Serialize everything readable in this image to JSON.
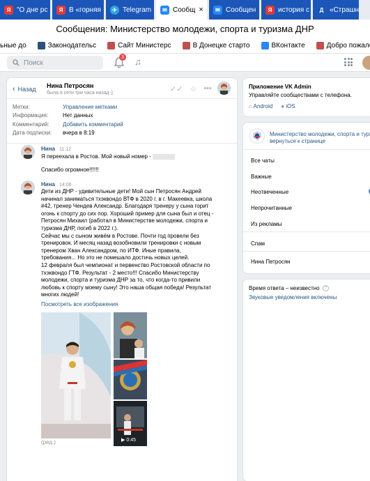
{
  "tabs": [
    {
      "icon": "Я",
      "kind": "y",
      "label": "\"О дне рс"
    },
    {
      "icon": "Я",
      "kind": "y",
      "label": "В «горняя"
    },
    {
      "icon": "✈",
      "kind": "tg",
      "label": "Telegram"
    },
    {
      "icon": "✉",
      "kind": "vk",
      "label": "Сообщ",
      "active": true,
      "close": "×"
    },
    {
      "icon": "✉",
      "kind": "vk",
      "label": "Сообщен"
    },
    {
      "icon": "Я",
      "kind": "y",
      "label": "история с"
    },
    {
      "icon": "Д",
      "kind": "d",
      "label": "«Страшн"
    }
  ],
  "window_title": "Сообщения: Министерство молодежи, спорта и туризма ДНР",
  "bookmarks": [
    {
      "label": "ьные до",
      "color": "#4a76a8"
    },
    {
      "label": "Законодательс",
      "color": "#2b5278"
    },
    {
      "label": "Сайт Министерс",
      "color": "#c0504d"
    },
    {
      "label": "В Донецке старто",
      "color": "#c0504d"
    },
    {
      "label": "ВКонтакте",
      "color": "#2787f5"
    },
    {
      "label": "Добро пожалова",
      "color": "#c0504d"
    }
  ],
  "vk_header": {
    "search_placeholder": "Поиск",
    "notifications_count": "3"
  },
  "chat": {
    "back_label": "Назад",
    "peer_name": "Нина Петросян",
    "peer_status": "была в сети три часа назад",
    "info": [
      {
        "key": "Метки:",
        "value": "Управление метками",
        "link": true
      },
      {
        "key": "Информация:",
        "value": "Нет данных",
        "link": false
      },
      {
        "key": "Комментарий:",
        "value": "Добавить комментарий",
        "link": true
      },
      {
        "key": "Дата подписки:",
        "value": "вчера в 8:19",
        "link": false
      }
    ],
    "messages": [
      {
        "author": "Нина",
        "time": "11:12",
        "text_before": "Я переехала в Ростов. Мой новый номер -",
        "text_after": "Спасибо огромное!!!!!!"
      },
      {
        "author": "Нина",
        "time": "14:06",
        "text": "Дети из ДНР - удивительные дети! Мой сын Петросян Андрей начинал заниматься тхэквондо ВТФ в 2020 г. в г. Макеевка, школа #42, тренер Чендев Александр. Благодаря тренеру у сына горит огонь к спорту до сих пор. Хороший пример для сына был и отец - Петросян Михаил (работал в Министерстве молодежи, спорта и туризма ДНР, погиб в 2022 г.).\nСейчас мы с сыном живём в Ростове. Почти год провели без тренировок. И месяц назад возобновили тренировки с новым тренером Хван Александром, по ИТФ. Иные правила, требования... Но это не помешало достичь новых целей.\n12 февраля был чемпионат и первенство Ростовской области по тхэквондо ГТФ. Результат - 2 место!!! Спасибо Министерству молодежи, спорта и туризма ДНР за то, что когда-то привили любовь к спорту моему сыну! Это наша общая победа! Результат многих людей!",
        "link": "Посмотреть все изображения",
        "video_duration": "0:45",
        "edited": "(ред.)"
      }
    ]
  },
  "right_panel": {
    "app_title": "Приложение VK Admin",
    "app_subtitle": "Управляйте сообществами с телефона.",
    "android": "Android",
    "ios": "iOS",
    "community_name": "Министерство молодежи, спорта и туриз",
    "community_back": "вернуться к странице",
    "menu": [
      "Все чаты",
      "Важные",
      "Неотвеченные",
      "Непрочитанные",
      "Из рекламы",
      "Спам",
      "Нина Петросян"
    ],
    "response_time": "Время ответа – неизвестно",
    "sound": "Звуковые уведомления включены"
  }
}
